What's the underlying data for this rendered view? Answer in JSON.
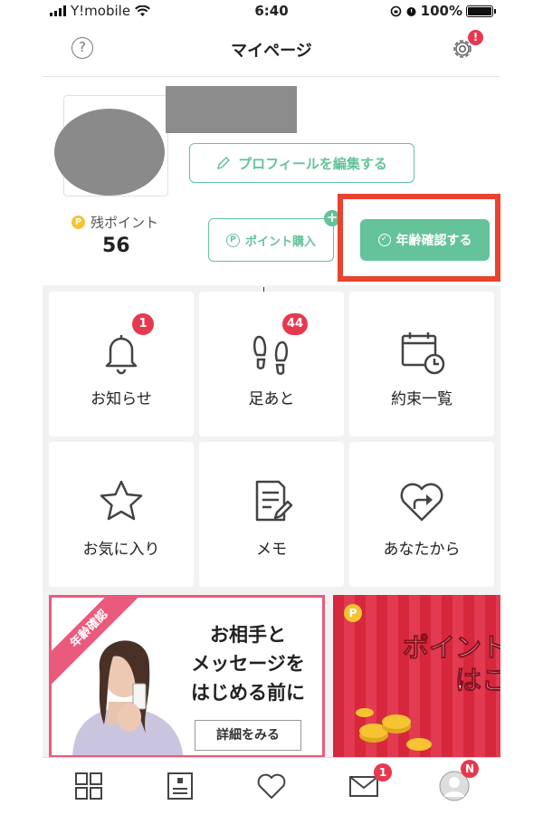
{
  "status_bar": {
    "carrier": "Y!mobile",
    "time": "6:40",
    "battery": "100%"
  },
  "header": {
    "title": "マイページ",
    "help_symbol": "?",
    "settings_badge": "!"
  },
  "profile": {
    "edit_button": "プロフィールを編集する",
    "points_label": "残ポイント",
    "points_coin": "P",
    "points_value": "56",
    "buy_button": "ポイント購入",
    "buy_badge": "+",
    "age_button": "年齢確認する"
  },
  "menu": [
    {
      "label": "お知らせ",
      "badge": "1",
      "icon": "bell-icon"
    },
    {
      "label": "足あと",
      "badge": "44",
      "icon": "footprints-icon"
    },
    {
      "label": "約束一覧",
      "badge": "",
      "icon": "calendar-clock-icon"
    },
    {
      "label": "お気に入り",
      "badge": "",
      "icon": "star-icon"
    },
    {
      "label": "メモ",
      "badge": "",
      "icon": "memo-icon"
    },
    {
      "label": "あなたから",
      "badge": "",
      "icon": "heart-arrow-icon"
    }
  ],
  "banners": {
    "age": {
      "ribbon": "年齢確認",
      "line1": "お相手と",
      "line2": "メッセージを",
      "line3": "はじめる前に",
      "button": "詳細をみる"
    },
    "points": {
      "coin": "P",
      "line1": "ポイント交",
      "line2": "はこち"
    }
  },
  "tabbar": {
    "items": [
      "grid-icon",
      "profile-card-icon",
      "heart-icon",
      "mail-icon",
      "user-avatar-icon"
    ],
    "mail_badge": "1",
    "profile_badge": "N"
  },
  "colors": {
    "accent": "#64c39a",
    "badge": "#e8384f",
    "highlight": "#e8432e",
    "banner_pink": "#ea5a7d"
  }
}
